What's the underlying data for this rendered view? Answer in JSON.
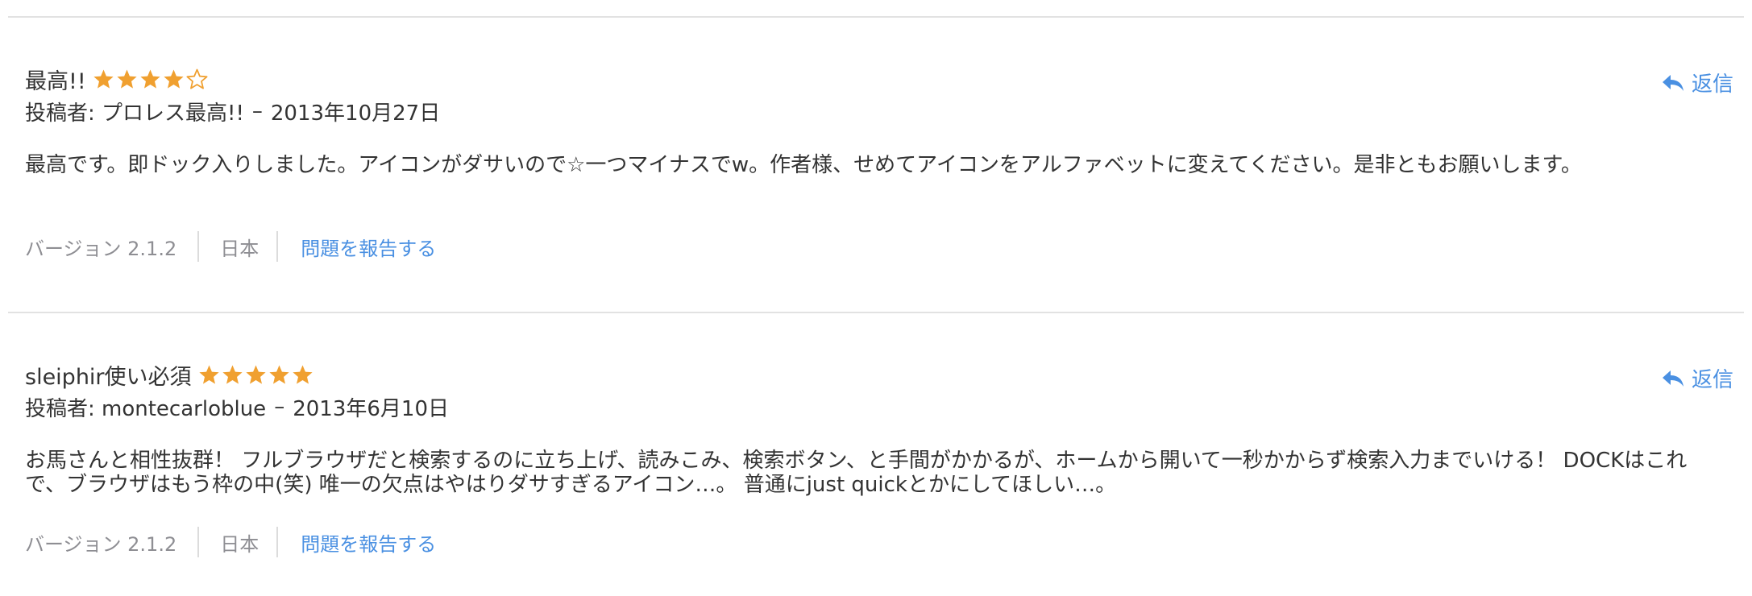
{
  "colors": {
    "star": "#f0a030",
    "link": "#4a90e2",
    "muted": "#8e8e93",
    "text": "#333333",
    "divider": "#e2e2e2"
  },
  "reviews": [
    {
      "title": "最高!!",
      "rating": 4,
      "rating_max": 5,
      "author_label": "投稿者: プロレス最高!!",
      "date_separator": "–",
      "date": "2013年10月27日",
      "body": "最高です。即ドック入りしました。アイコンがダサいので☆一つマイナスでw。作者様、せめてアイコンをアルファベットに変えてください。是非ともお願いします。",
      "version": "バージョン 2.1.2",
      "country": "日本",
      "report_label": "問題を報告する",
      "reply_label": "返信",
      "reply_icon": "reply-arrow-icon"
    },
    {
      "title": "sleiphir使い必須",
      "rating": 5,
      "rating_max": 5,
      "author_label": "投稿者: montecarloblue",
      "date_separator": "–",
      "date": "2013年6月10日",
      "body": "お馬さんと相性抜群！ フルブラウザだと検索するのに立ち上げ、読みこみ、検索ボタン、と手間がかかるが、ホームから開いて一秒かからず検索入力までいける！ DOCKはこれで、ブラウザはもう枠の中(笑) 唯一の欠点はやはりダサすぎるアイコン…。 普通にjust quickとかにしてほしい…。",
      "version": "バージョン 2.1.2",
      "country": "日本",
      "report_label": "問題を報告する",
      "reply_label": "返信",
      "reply_icon": "reply-arrow-icon"
    }
  ]
}
